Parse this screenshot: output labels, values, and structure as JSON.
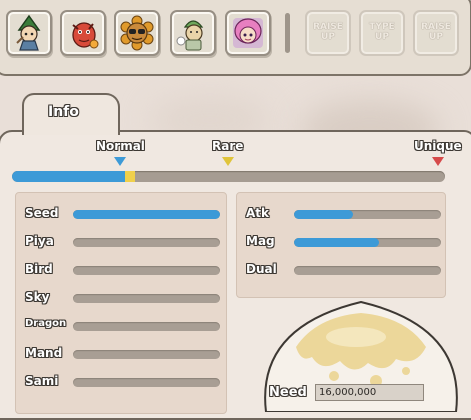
{
  "characters": [
    {
      "name": "green-hood-character"
    },
    {
      "name": "red-dragon-character"
    },
    {
      "name": "sunglasses-sunflower-character"
    },
    {
      "name": "green-cap-character"
    },
    {
      "name": "pink-hair-character"
    }
  ],
  "locked_slots": [
    {
      "label": "RAISE UP"
    },
    {
      "label": "TYPE UP"
    },
    {
      "label": "RAISE UP"
    }
  ],
  "tab": {
    "label": "Info"
  },
  "grade": {
    "labels": [
      "Normal",
      "Rare",
      "Unique"
    ],
    "marker_colors": [
      "#3d9ad7",
      "#e0c43a",
      "#d64a4a"
    ],
    "progress": 0.26,
    "exp_segment": 0.025
  },
  "stats_left": [
    {
      "label": "Seed",
      "value": 1.0
    },
    {
      "label": "Piya",
      "value": 0
    },
    {
      "label": "Bird",
      "value": 0
    },
    {
      "label": "Sky",
      "value": 0
    },
    {
      "label": "Dragon",
      "value": 0
    },
    {
      "label": "Mand",
      "value": 0
    },
    {
      "label": "Sami",
      "value": 0
    }
  ],
  "stats_right": [
    {
      "label": "Atk",
      "value": 0.4
    },
    {
      "label": "Mag",
      "value": 0.58
    },
    {
      "label": "Dual",
      "value": 0
    }
  ],
  "need": {
    "label": "Need",
    "value": "16,000,000"
  }
}
